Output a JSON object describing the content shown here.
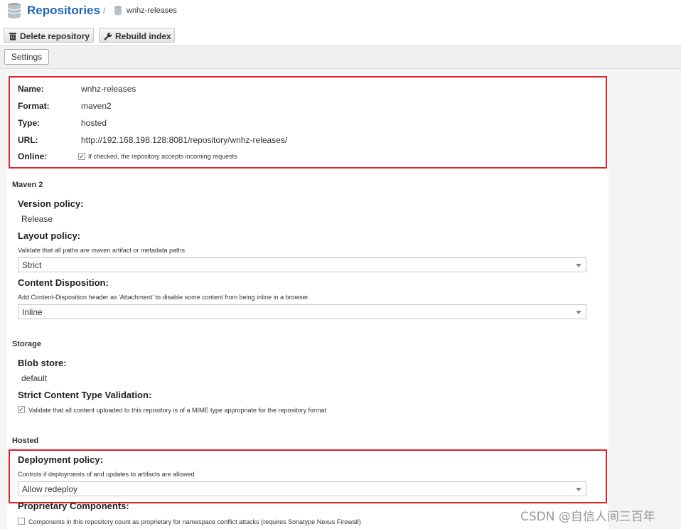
{
  "header": {
    "title": "Repositories",
    "separator": "/",
    "breadcrumb_current": "wnhz-releases",
    "icons": {
      "title": "database-icon",
      "breadcrumb": "database-icon"
    }
  },
  "toolbar": {
    "delete_label": "Delete repository",
    "rebuild_label": "Rebuild index",
    "icons": {
      "delete": "trash-icon",
      "rebuild": "wrench-icon"
    }
  },
  "tabs": [
    {
      "label": "Settings"
    }
  ],
  "repository": {
    "name_label": "Name:",
    "name_value": "wnhz-releases",
    "format_label": "Format:",
    "format_value": "maven2",
    "type_label": "Type:",
    "type_value": "hosted",
    "url_label": "URL:",
    "url_value": "http://192.168.198.128:8081/repository/wnhz-releases/",
    "online_label": "Online:",
    "online_checked": true,
    "online_help": "If checked, the repository accepts incoming requests"
  },
  "maven2": {
    "section_title": "Maven 2",
    "version_policy_label": "Version policy:",
    "version_policy_value": "Release",
    "layout_policy_label": "Layout policy:",
    "layout_policy_help": "Validate that all paths are maven artifact or metadata paths",
    "layout_policy_value": "Strict",
    "content_disposition_label": "Content Disposition:",
    "content_disposition_help": "Add Content-Disposition header as 'Attachment' to disable some content from being inline in a browser.",
    "content_disposition_value": "Inline"
  },
  "storage": {
    "section_title": "Storage",
    "blob_store_label": "Blob store:",
    "blob_store_value": "default",
    "strict_validation_label": "Strict Content Type Validation:",
    "strict_validation_checked": true,
    "strict_validation_help": "Validate that all content uploaded to this repository is of a MIME type appropriate for the repository format"
  },
  "hosted": {
    "section_title": "Hosted",
    "deployment_policy_label": "Deployment policy:",
    "deployment_policy_help": "Controls if deployments of and updates to artifacts are allowed",
    "deployment_policy_value": "Allow redeploy",
    "proprietary_label": "Proprietary Components:",
    "proprietary_checked": false,
    "proprietary_help": "Components in this repository count as proprietary for namespace conflict attacks (requires Sonatype Nexus Firewall)"
  },
  "watermark": "CSDN @自信人间三百年",
  "colors": {
    "link_blue": "#2168b5",
    "highlight_red": "#e0202a"
  }
}
